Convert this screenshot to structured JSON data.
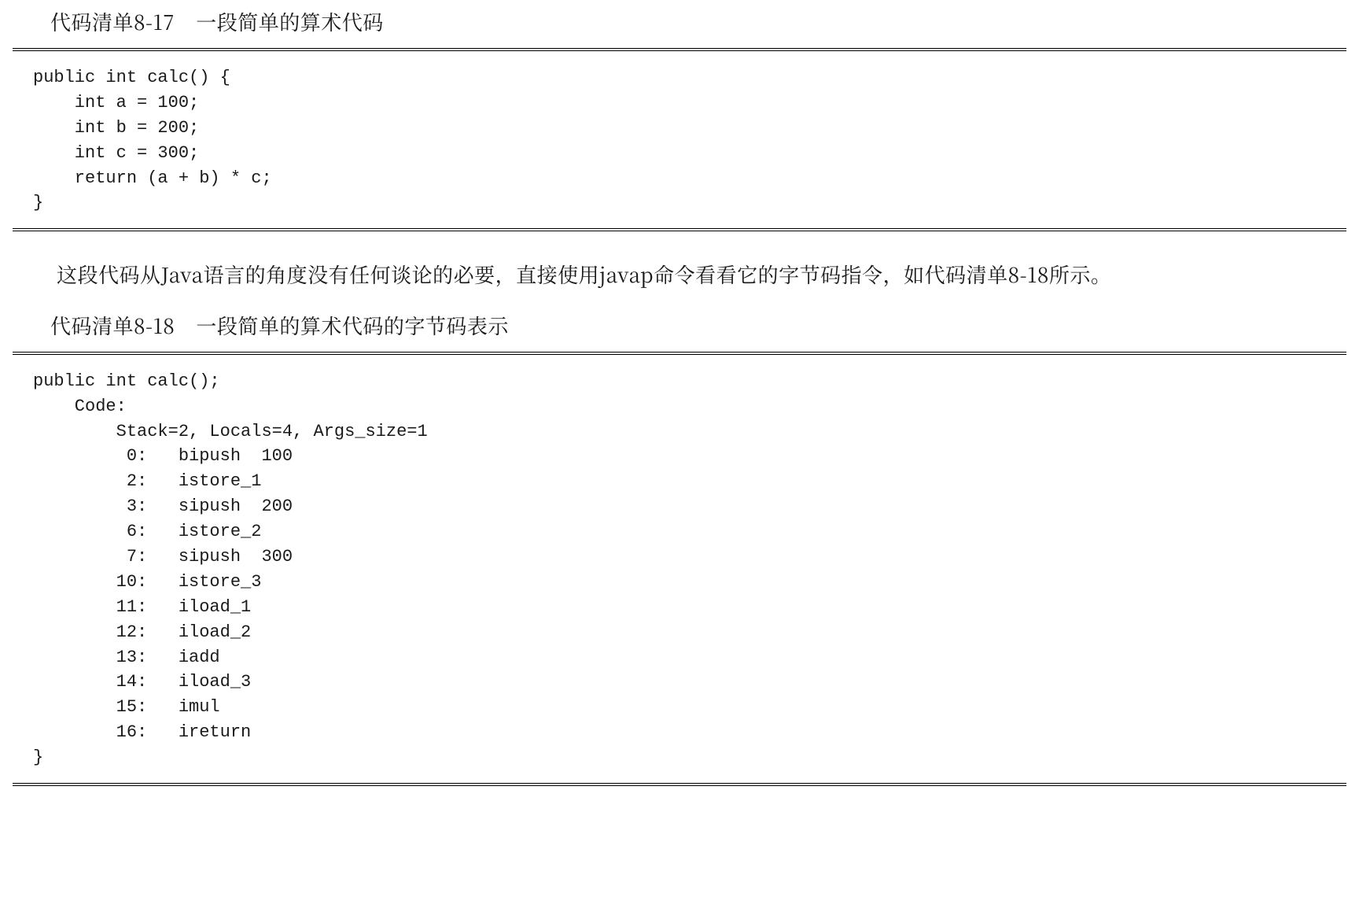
{
  "listing1": {
    "id": "代码清单8-17",
    "caption": "一段简单的算术代码",
    "code": "public int calc() {\n    int a = 100;\n    int b = 200;\n    int c = 300;\n    return (a + b) * c;\n}"
  },
  "paragraph": "这段代码从Java语言的角度没有任何谈论的必要，直接使用javap命令看看它的字节码指令，如代码清单8-18所示。",
  "listing2": {
    "id": "代码清单8-18",
    "caption": "一段简单的算术代码的字节码表示",
    "code": "public int calc();\n    Code:\n        Stack=2, Locals=4, Args_size=1\n         0:   bipush  100\n         2:   istore_1\n         3:   sipush  200\n         6:   istore_2\n         7:   sipush  300\n        10:   istore_3\n        11:   iload_1\n        12:   iload_2\n        13:   iadd\n        14:   iload_3\n        15:   imul\n        16:   ireturn\n}"
  }
}
